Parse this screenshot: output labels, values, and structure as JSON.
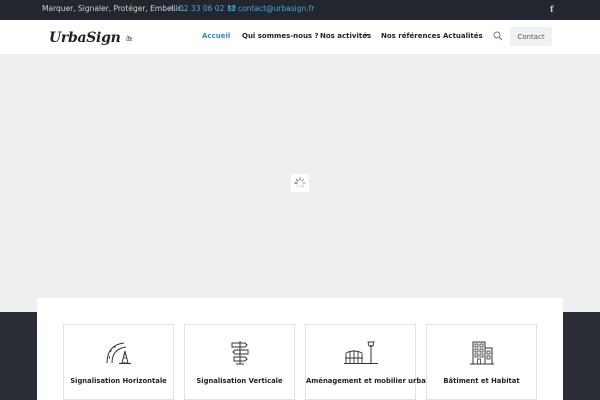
{
  "topbar": {
    "tagline": "Marquer, Signaler, Protéger, Embellir...",
    "phone": "02 33 06 02 12",
    "email": "contact@urbasign.fr",
    "social_fb": "f"
  },
  "header": {
    "logo_text": "UrbaSign",
    "nav": [
      {
        "label": "Accueil"
      },
      {
        "label": "Qui sommes-nous ?"
      },
      {
        "label": "Nos activités"
      },
      {
        "label": "Nos références"
      },
      {
        "label": "Actualités"
      }
    ],
    "contact_label": "Contact"
  },
  "services": [
    {
      "label": "Signalisation Horizontale",
      "icon": "road-cone-icon"
    },
    {
      "label": "Signalisation Verticale",
      "icon": "signpost-icon"
    },
    {
      "label": "Aménagement et mobilier urbain",
      "icon": "street-furniture-icon"
    },
    {
      "label": "Bâtiment et Habitat",
      "icon": "building-icon"
    }
  ],
  "colors": {
    "topbar_bg": "#24262e",
    "accent": "#3a87c7",
    "hero_bg": "#efeff0",
    "band_bg": "#2b2d37"
  }
}
